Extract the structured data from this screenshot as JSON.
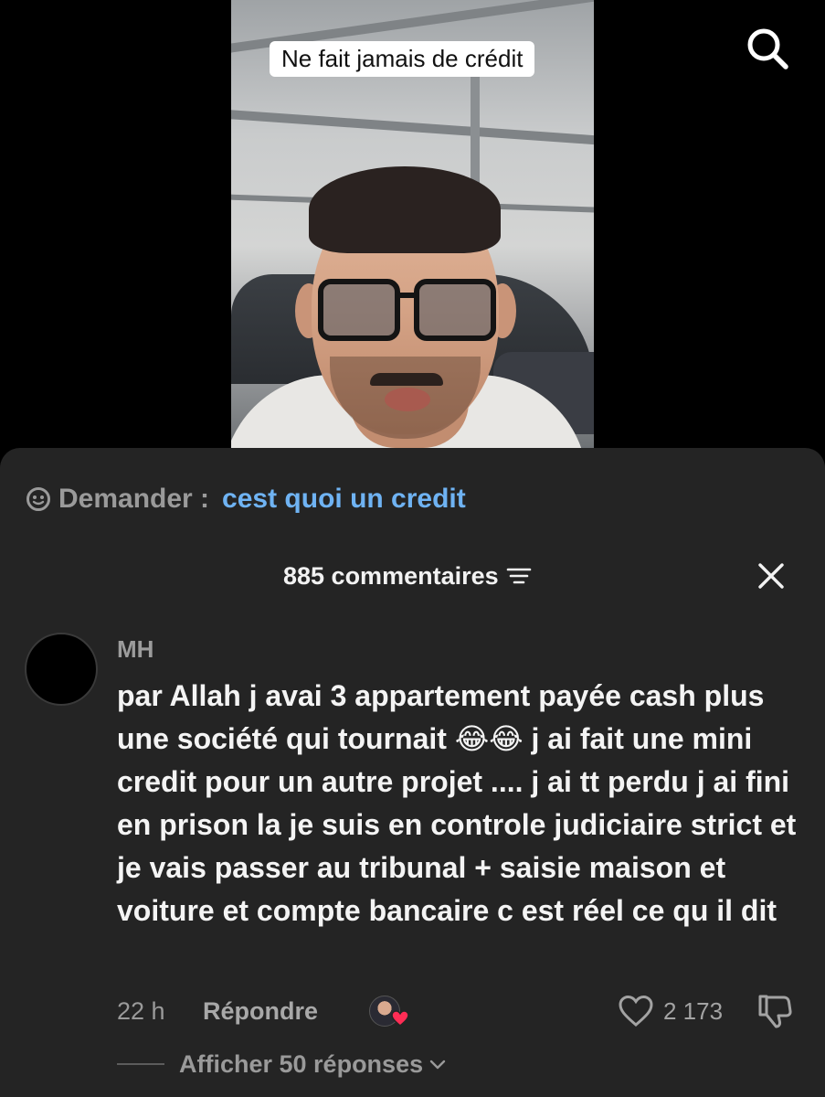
{
  "video": {
    "caption": "Ne fait jamais de crédit"
  },
  "top_bar": {
    "search_icon": "search-icon"
  },
  "ask_bar": {
    "icon": "smile-search-icon",
    "label": "Demander :",
    "query": "cest quoi un credit"
  },
  "comments_header": {
    "count_label": "885 commentaires",
    "sort_icon": "sort-filter-icon",
    "close_icon": "close-icon"
  },
  "comment": {
    "username": "MH",
    "text": "par Allah j avai 3 appartement payée cash plus une société qui tournait 😂😂 j ai fait une mini credit pour un autre projet .... j ai tt perdu j ai fini en prison la je suis en controle judiciaire strict et je vais passer au tribunal + saisie maison et voiture et compte bancaire c est réel ce qu il dit",
    "time": "22 h",
    "reply_label": "Répondre",
    "like_count": "2 173",
    "replies_label": "Afficher 50 réponses"
  },
  "colors": {
    "sheet_bg": "#242424",
    "accent_link": "#6fb3f3",
    "muted_text": "#9a9a9a",
    "heart_badge": "#ff2d55"
  }
}
